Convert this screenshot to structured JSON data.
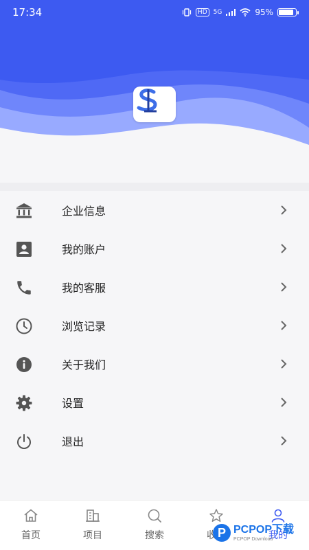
{
  "status_bar": {
    "time": "17:34",
    "hd_label": "HD",
    "network_label": "5G",
    "battery_text": "95%",
    "battery_level": 0.95
  },
  "header": {
    "logo_icon": "app-logo-s-icon",
    "colors": {
      "primary": "#3d5af1",
      "wave_light": "#8ea2ff"
    }
  },
  "menu": {
    "items": [
      {
        "label": "企业信息",
        "icon": "bank-icon"
      },
      {
        "label": "我的账户",
        "icon": "account-box-icon"
      },
      {
        "label": "我的客服",
        "icon": "phone-icon"
      },
      {
        "label": "浏览记录",
        "icon": "clock-icon"
      },
      {
        "label": "关于我们",
        "icon": "info-icon"
      },
      {
        "label": "设置",
        "icon": "gear-icon"
      },
      {
        "label": "退出",
        "icon": "power-icon"
      }
    ]
  },
  "bottom_nav": {
    "active": "我的",
    "items": [
      {
        "label": "首页",
        "icon": "home-icon"
      },
      {
        "label": "项目",
        "icon": "building-icon"
      },
      {
        "label": "搜索",
        "icon": "search-icon"
      },
      {
        "label": "收藏",
        "icon": "star-icon"
      },
      {
        "label": "我的",
        "icon": "person-icon"
      }
    ]
  },
  "watermark": {
    "letter": "P",
    "main": "PCPOP下载",
    "sub": "PCPOP Download"
  }
}
